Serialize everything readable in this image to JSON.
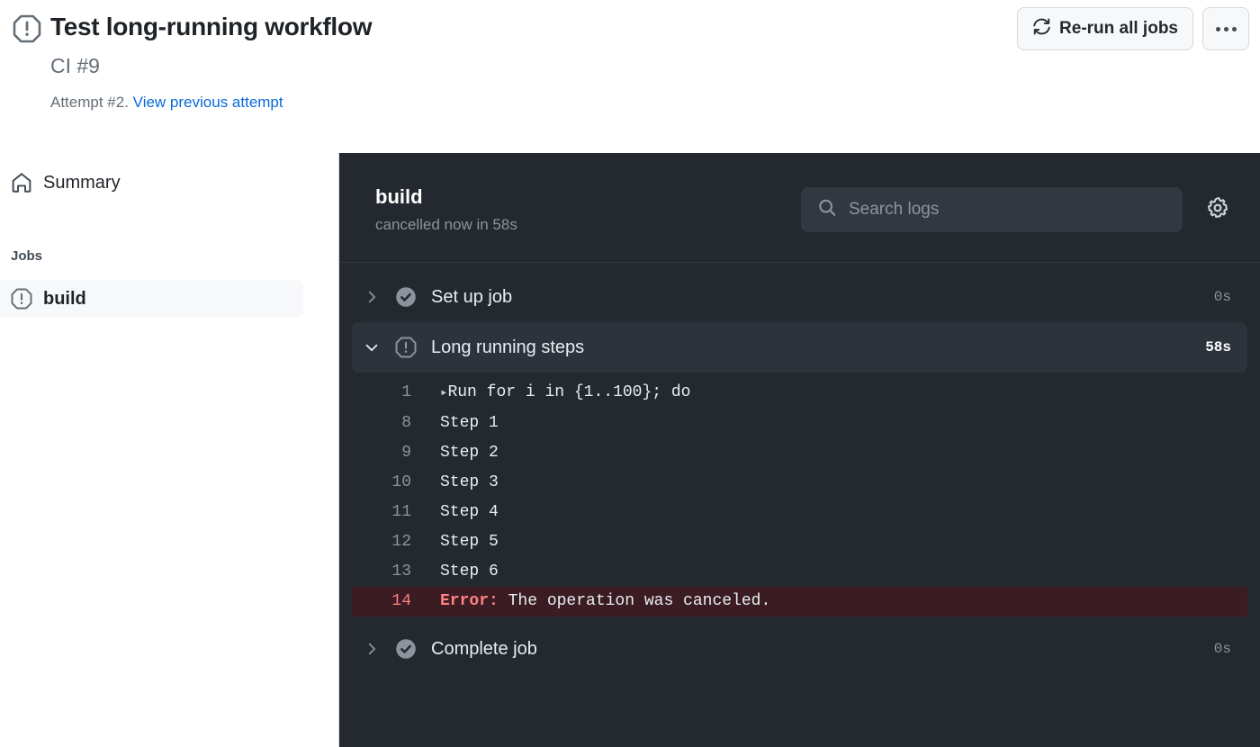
{
  "header": {
    "status_icon": "cancelled-octagon-icon",
    "title": "Test long-running workflow",
    "subtitle": "CI #9",
    "attempt_text": "Attempt #2.",
    "attempt_link": "View previous attempt",
    "rerun_button": "Re-run all jobs",
    "rerun_icon": "sync-icon",
    "kebab_icon": "kebab-horizontal-icon"
  },
  "sidebar": {
    "summary_label": "Summary",
    "summary_icon": "home-icon",
    "jobs_heading": "Jobs",
    "jobs": [
      {
        "label": "build",
        "icon": "cancelled-octagon-icon",
        "selected": true
      }
    ]
  },
  "log_panel": {
    "job_name": "build",
    "job_status": "cancelled now in 58s",
    "search_placeholder": "Search logs",
    "search_value": "",
    "search_icon": "search-icon",
    "settings_icon": "gear-icon",
    "steps": [
      {
        "name": "Set up job",
        "icon": "check-circle-icon",
        "duration": "0s",
        "expanded": false,
        "chevron": "chevron-right-icon"
      },
      {
        "name": "Long running steps",
        "icon": "cancelled-octagon-icon",
        "duration": "58s",
        "expanded": true,
        "chevron": "chevron-down-icon"
      },
      {
        "name": "Complete job",
        "icon": "check-circle-icon",
        "duration": "0s",
        "expanded": false,
        "chevron": "chevron-right-icon"
      }
    ],
    "log_lines": [
      {
        "number": "1",
        "marker": "▸",
        "text": "Run for i in {1..100}; do",
        "error": false
      },
      {
        "number": "8",
        "marker": "",
        "text": "Step 1",
        "error": false
      },
      {
        "number": "9",
        "marker": "",
        "text": "Step 2",
        "error": false
      },
      {
        "number": "10",
        "marker": "",
        "text": "Step 3",
        "error": false
      },
      {
        "number": "11",
        "marker": "",
        "text": "Step 4",
        "error": false
      },
      {
        "number": "12",
        "marker": "",
        "text": "Step 5",
        "error": false
      },
      {
        "number": "13",
        "marker": "",
        "text": "Step 6",
        "error": false
      },
      {
        "number": "14",
        "marker": "",
        "error": true,
        "error_label": "Error:",
        "text": " The operation was canceled."
      }
    ]
  },
  "colors": {
    "link": "#0969da",
    "panel_bg": "#24292f",
    "row_active": "#2d333b",
    "error_bg": "#3c1c23",
    "error_fg": "#ff8182",
    "muted": "#8b949e",
    "sidebar_selected": "#f6f8fa"
  }
}
